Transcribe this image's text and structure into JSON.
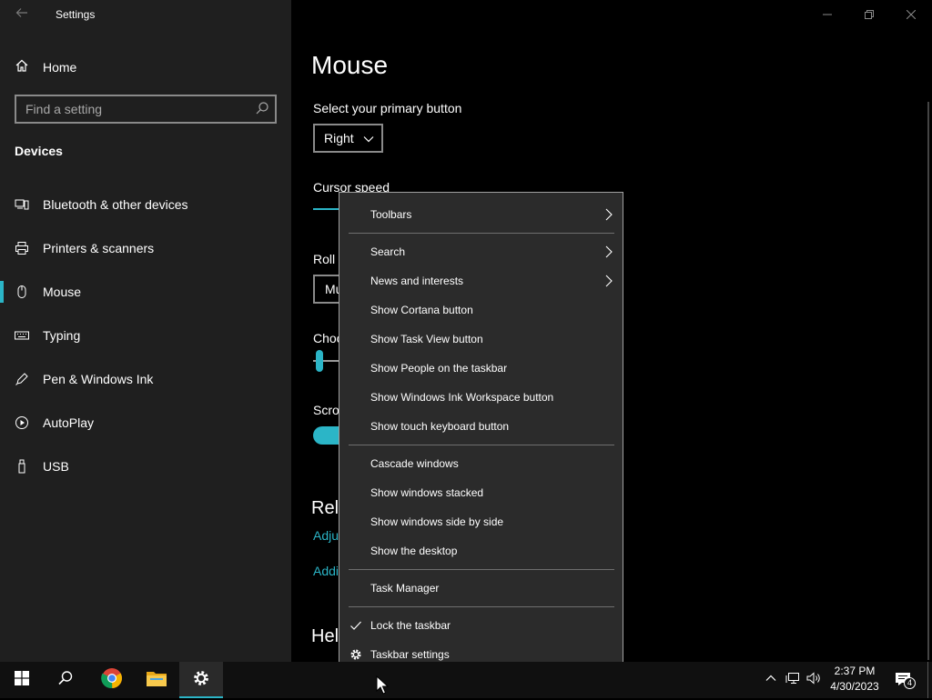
{
  "window": {
    "app_title": "Settings"
  },
  "sidebar": {
    "home_label": "Home",
    "search_placeholder": "Find a setting",
    "section_title": "Devices",
    "items": [
      {
        "label": "Bluetooth & other devices",
        "icon": "bluetooth-devices-icon"
      },
      {
        "label": "Printers & scanners",
        "icon": "printer-icon"
      },
      {
        "label": "Mouse",
        "icon": "mouse-icon",
        "active": true
      },
      {
        "label": "Typing",
        "icon": "keyboard-icon"
      },
      {
        "label": "Pen & Windows Ink",
        "icon": "pen-icon"
      },
      {
        "label": "AutoPlay",
        "icon": "autoplay-icon"
      },
      {
        "label": "USB",
        "icon": "usb-icon"
      }
    ]
  },
  "main": {
    "title": "Mouse",
    "primary_button_label": "Select your primary button",
    "primary_button_value": "Right",
    "cursor_speed_label": "Cursor speed",
    "roll_label": "Roll",
    "roll_value": "Mu",
    "choose_label": "Choo",
    "scroll_label": "Scro",
    "related_heading": "Rela",
    "link_1": "Adju",
    "link_2": "Addi",
    "help_heading": "Hel"
  },
  "context_menu": {
    "items": [
      {
        "label": "Toolbars",
        "submenu": true
      },
      {
        "label": "Search",
        "submenu": true
      },
      {
        "label": "News and interests",
        "submenu": true
      },
      {
        "label": "Show Cortana button"
      },
      {
        "label": "Show Task View button"
      },
      {
        "label": "Show People on the taskbar"
      },
      {
        "label": "Show Windows Ink Workspace button"
      },
      {
        "label": "Show touch keyboard button"
      },
      {
        "label": "Cascade windows"
      },
      {
        "label": "Show windows stacked"
      },
      {
        "label": "Show windows side by side"
      },
      {
        "label": "Show the desktop"
      },
      {
        "label": "Task Manager"
      },
      {
        "label": "Lock the taskbar",
        "checked": true
      },
      {
        "label": "Taskbar settings",
        "icon": "gear-icon"
      }
    ]
  },
  "taskbar": {
    "time": "2:37 PM",
    "date": "4/30/2023",
    "notification_count": "4"
  },
  "colors": {
    "accent": "#2bb5c7",
    "sidebar_bg": "#1f1f1f",
    "menu_bg": "#2b2b2b",
    "taskbar_bg": "#101010"
  }
}
